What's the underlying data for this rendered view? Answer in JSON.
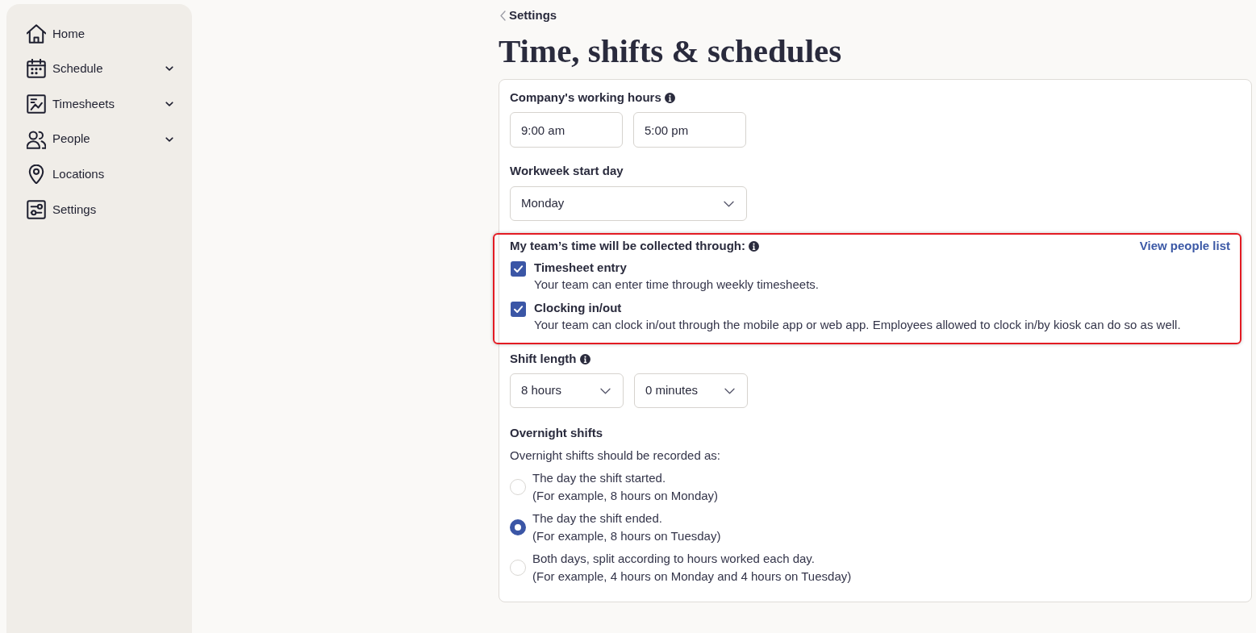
{
  "sidebar": {
    "items": [
      {
        "label": "Home",
        "expandable": false,
        "selected": false
      },
      {
        "label": "Schedule",
        "expandable": true,
        "selected": false
      },
      {
        "label": "Timesheets",
        "expandable": true,
        "selected": false
      },
      {
        "label": "People",
        "expandable": true,
        "selected": false
      },
      {
        "label": "Locations",
        "expandable": false,
        "selected": false
      },
      {
        "label": "Settings",
        "expandable": false,
        "selected": false
      }
    ]
  },
  "breadcrumb": {
    "label": "Settings"
  },
  "title": "Time, shifts & schedules",
  "working_hours": {
    "label": "Company's working hours",
    "fields": [
      {
        "value": "9:00 am"
      },
      {
        "value": "5:00 pm"
      }
    ]
  },
  "workweek_start": {
    "label": "Workweek start day",
    "value": "Monday"
  },
  "time_collection": {
    "label": "My team’s time will be collected through:",
    "link": "View people list",
    "highlighted": true,
    "options": [
      {
        "label": "Timesheet entry",
        "description": "Your team can enter time through weekly timesheets.",
        "checked": true
      },
      {
        "label": "Clocking in/out",
        "description": "Your team can clock in/out through the mobile app or web app. Employees allowed to clock in/by kiosk can do so as well.",
        "checked": true
      }
    ]
  },
  "shift_length": {
    "label": "Shift length",
    "selects": [
      {
        "value": "8 hours"
      },
      {
        "value": "0 minutes"
      }
    ]
  },
  "overnight_shifts": {
    "label": "Overnight shifts",
    "prompt": "Overnight shifts should be recorded as:",
    "options": [
      {
        "label": "The day the shift started.",
        "example": "(For example, 8 hours on Monday)",
        "selected": false
      },
      {
        "label": "The day the shift ended.",
        "example": "(For example, 8 hours on Tuesday)",
        "selected": true
      },
      {
        "label": "Both days, split according to hours worked each day.",
        "example": "(For example, 4 hours on Monday and 4 hours on Tuesday)",
        "selected": false
      }
    ]
  }
}
